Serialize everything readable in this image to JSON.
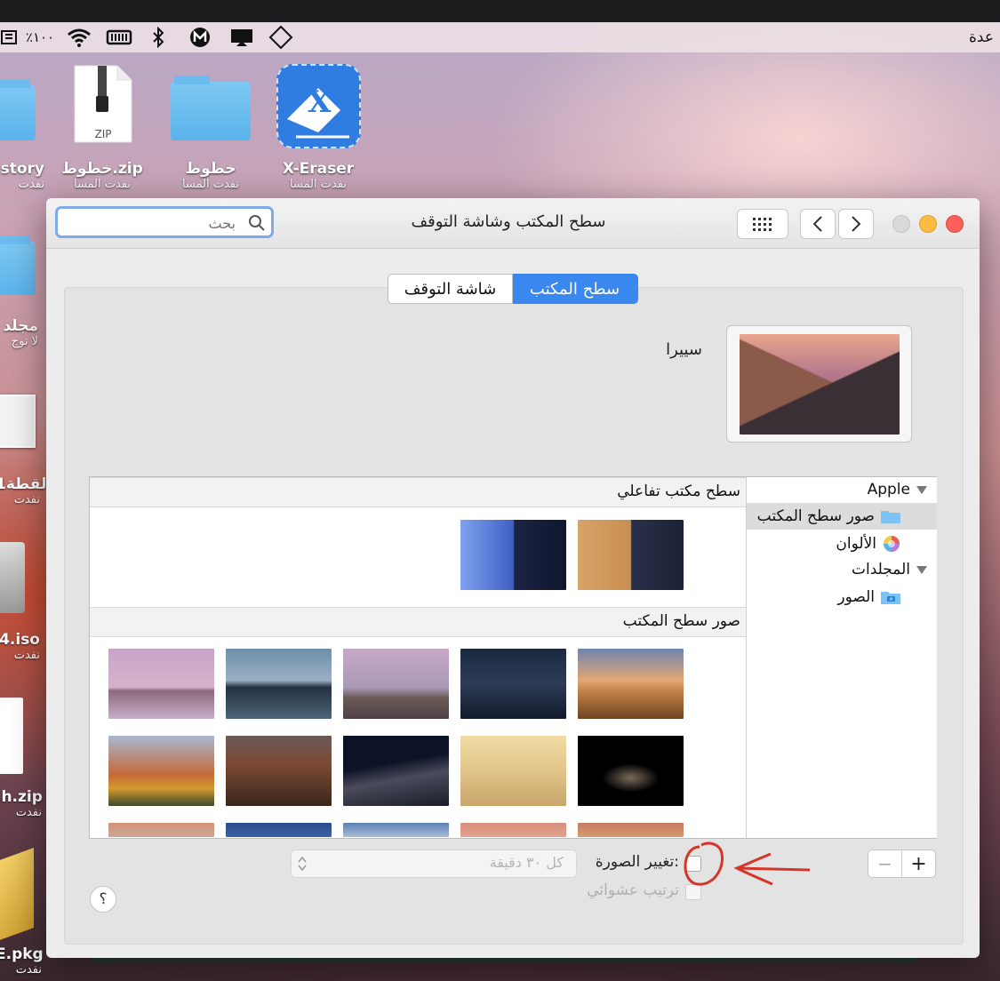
{
  "menubar": {
    "right_fragment": "عدة",
    "battery": "٪١٠٠",
    "icons": [
      "input-source-icon",
      "battery-icon",
      "wifi-icon",
      "memory-icon",
      "bluetooth-icon",
      "m-app-icon",
      "display-icon",
      "diamond-icon"
    ]
  },
  "desktop": {
    "items": [
      {
        "name": "story",
        "sub": "نفدت"
      },
      {
        "name": "خطوط.zip",
        "sub": "نفدت المسا"
      },
      {
        "name": "خطوط",
        "sub": "نفدت المسا"
      },
      {
        "name": "X-Eraser",
        "sub": "نفدت المسا"
      },
      {
        "name": "مجلد",
        "sub": "لا توج"
      },
      {
        "name": "لقطة1",
        "sub": "نفدت"
      },
      {
        "name": "4.iso",
        "sub": "نفدت"
      },
      {
        "name": ".h.zip",
        "sub": "نفدت"
      },
      {
        "name": "E.pkg",
        "sub": "نفدت"
      }
    ],
    "zip_label": "ZIP"
  },
  "window": {
    "title": "سطح المكتب وشاشة التوقف",
    "search_placeholder": "بحث",
    "tabs": [
      {
        "label": "سطح المكتب",
        "selected": true
      },
      {
        "label": "شاشة التوقف",
        "selected": false
      }
    ],
    "current_wallpaper": "سييرا",
    "sidebar": {
      "apple": "Apple",
      "desktop_pictures": "صور سطح المكتب",
      "colors": "الألوان",
      "folders": "المجلدات",
      "photos": "الصور"
    },
    "sections": {
      "dynamic": "سطح مكتب تفاعلي",
      "desktop_pictures": "صور سطح المكتب"
    },
    "change_picture_label": "تغيير الصورة:",
    "interval": "كل ٣٠ دقيقة",
    "random_order": "ترتيب عشوائي",
    "help": "؟",
    "add": "+",
    "remove": "−"
  },
  "colors": {
    "accent": "#3b87f0",
    "close": "#fc605b",
    "minimize": "#fdbc40",
    "annotation": "#d4362a"
  }
}
